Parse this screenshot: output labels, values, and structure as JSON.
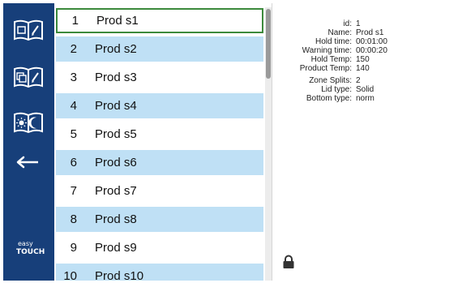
{
  "sidebar": {
    "logo_top": "easy",
    "logo_bottom": "TOUCH"
  },
  "products": [
    {
      "num": "1",
      "name": "Prod s1"
    },
    {
      "num": "2",
      "name": "Prod s2"
    },
    {
      "num": "3",
      "name": "Prod s3"
    },
    {
      "num": "4",
      "name": "Prod s4"
    },
    {
      "num": "5",
      "name": "Prod s5"
    },
    {
      "num": "6",
      "name": "Prod s6"
    },
    {
      "num": "7",
      "name": "Prod s7"
    },
    {
      "num": "8",
      "name": "Prod s8"
    },
    {
      "num": "9",
      "name": "Prod s9"
    },
    {
      "num": "10",
      "name": "Prod s10"
    }
  ],
  "details": [
    {
      "label": "id:",
      "value": "1"
    },
    {
      "label": "Name:",
      "value": "Prod s1"
    },
    {
      "label": "Hold time:",
      "value": "00:01:00"
    },
    {
      "label": "Warning time:",
      "value": "00:00:20"
    },
    {
      "label": "Hold Temp:",
      "value": "150"
    },
    {
      "label": "Product Temp:",
      "value": "140"
    },
    {
      "label": "Zone Splits:",
      "value": "2"
    },
    {
      "label": "Lid type:",
      "value": "Solid"
    },
    {
      "label": "Bottom type:",
      "value": "norm"
    }
  ],
  "colors": {
    "sidebar": "#173f7a",
    "row_alt": "#bfe0f5",
    "selected_border": "#3c8a3c"
  }
}
